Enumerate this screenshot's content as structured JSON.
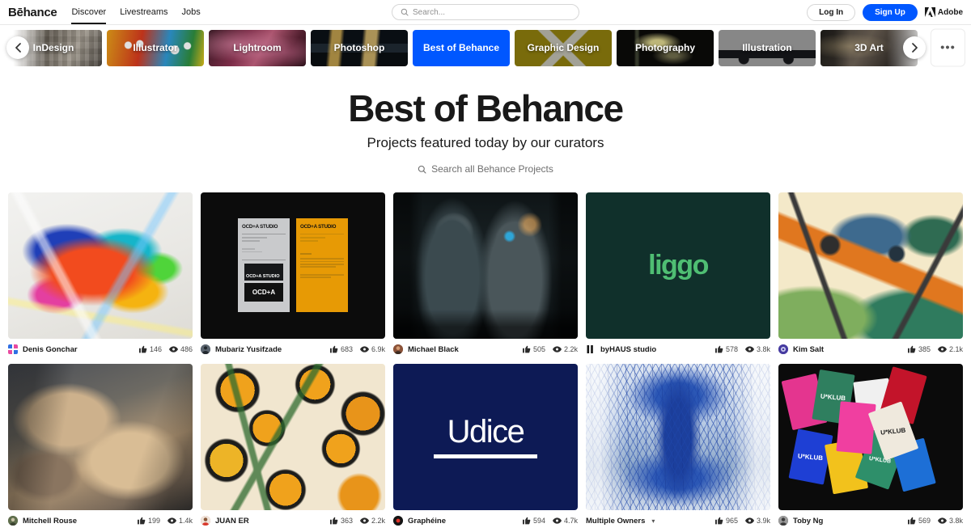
{
  "header": {
    "brand": "Bēhance",
    "nav": [
      {
        "label": "Discover",
        "active": true
      },
      {
        "label": "Livestreams",
        "active": false
      },
      {
        "label": "Jobs",
        "active": false
      }
    ],
    "search_placeholder": "Search...",
    "login_label": "Log In",
    "signup_label": "Sign Up",
    "adobe_label": "Adobe",
    "accent_color": "#0057ff"
  },
  "carousel": {
    "prev_label": "‹",
    "next_label": "›",
    "more_label": "•••",
    "categories": [
      {
        "label": "InDesign",
        "active": false
      },
      {
        "label": "Illustrator",
        "active": false
      },
      {
        "label": "Lightroom",
        "active": false
      },
      {
        "label": "Photoshop",
        "active": false
      },
      {
        "label": "Best of Behance",
        "active": true
      },
      {
        "label": "Graphic Design",
        "active": false
      },
      {
        "label": "Photography",
        "active": false
      },
      {
        "label": "Illustration",
        "active": false
      },
      {
        "label": "3D Art",
        "active": false
      }
    ]
  },
  "hero": {
    "title": "Best of Behance",
    "subtitle": "Projects featured today by our curators",
    "search_label": "Search all Behance Projects"
  },
  "projects": [
    {
      "owner": "Denis Gonchar",
      "likes": "146",
      "views": "486",
      "multiple_owners": false
    },
    {
      "owner": "Mubariz Yusifzade",
      "likes": "683",
      "views": "6.9k",
      "multiple_owners": false
    },
    {
      "owner": "Michael Black",
      "likes": "505",
      "views": "2.2k",
      "multiple_owners": false
    },
    {
      "owner": "byHAUS studio",
      "likes": "578",
      "views": "3.8k",
      "multiple_owners": false
    },
    {
      "owner": "Kim Salt",
      "likes": "385",
      "views": "2.1k",
      "multiple_owners": false
    },
    {
      "owner": "Mitchell Rouse",
      "likes": "199",
      "views": "1.4k",
      "multiple_owners": false
    },
    {
      "owner": "JUAN ER",
      "likes": "363",
      "views": "2.2k",
      "multiple_owners": false
    },
    {
      "owner": "Graphéine",
      "likes": "594",
      "views": "4.7k",
      "multiple_owners": false
    },
    {
      "owner": "Multiple Owners",
      "likes": "965",
      "views": "3.9k",
      "multiple_owners": true
    },
    {
      "owner": "Toby Ng",
      "likes": "569",
      "views": "3.8k",
      "multiple_owners": false
    }
  ],
  "thumbnail_text": {
    "ocd_title": "OCD+A STUDIO",
    "ocd_mark": "OCD+A",
    "liggo": "liggo",
    "udice": "Udice",
    "uklub": "U*KLUB"
  }
}
